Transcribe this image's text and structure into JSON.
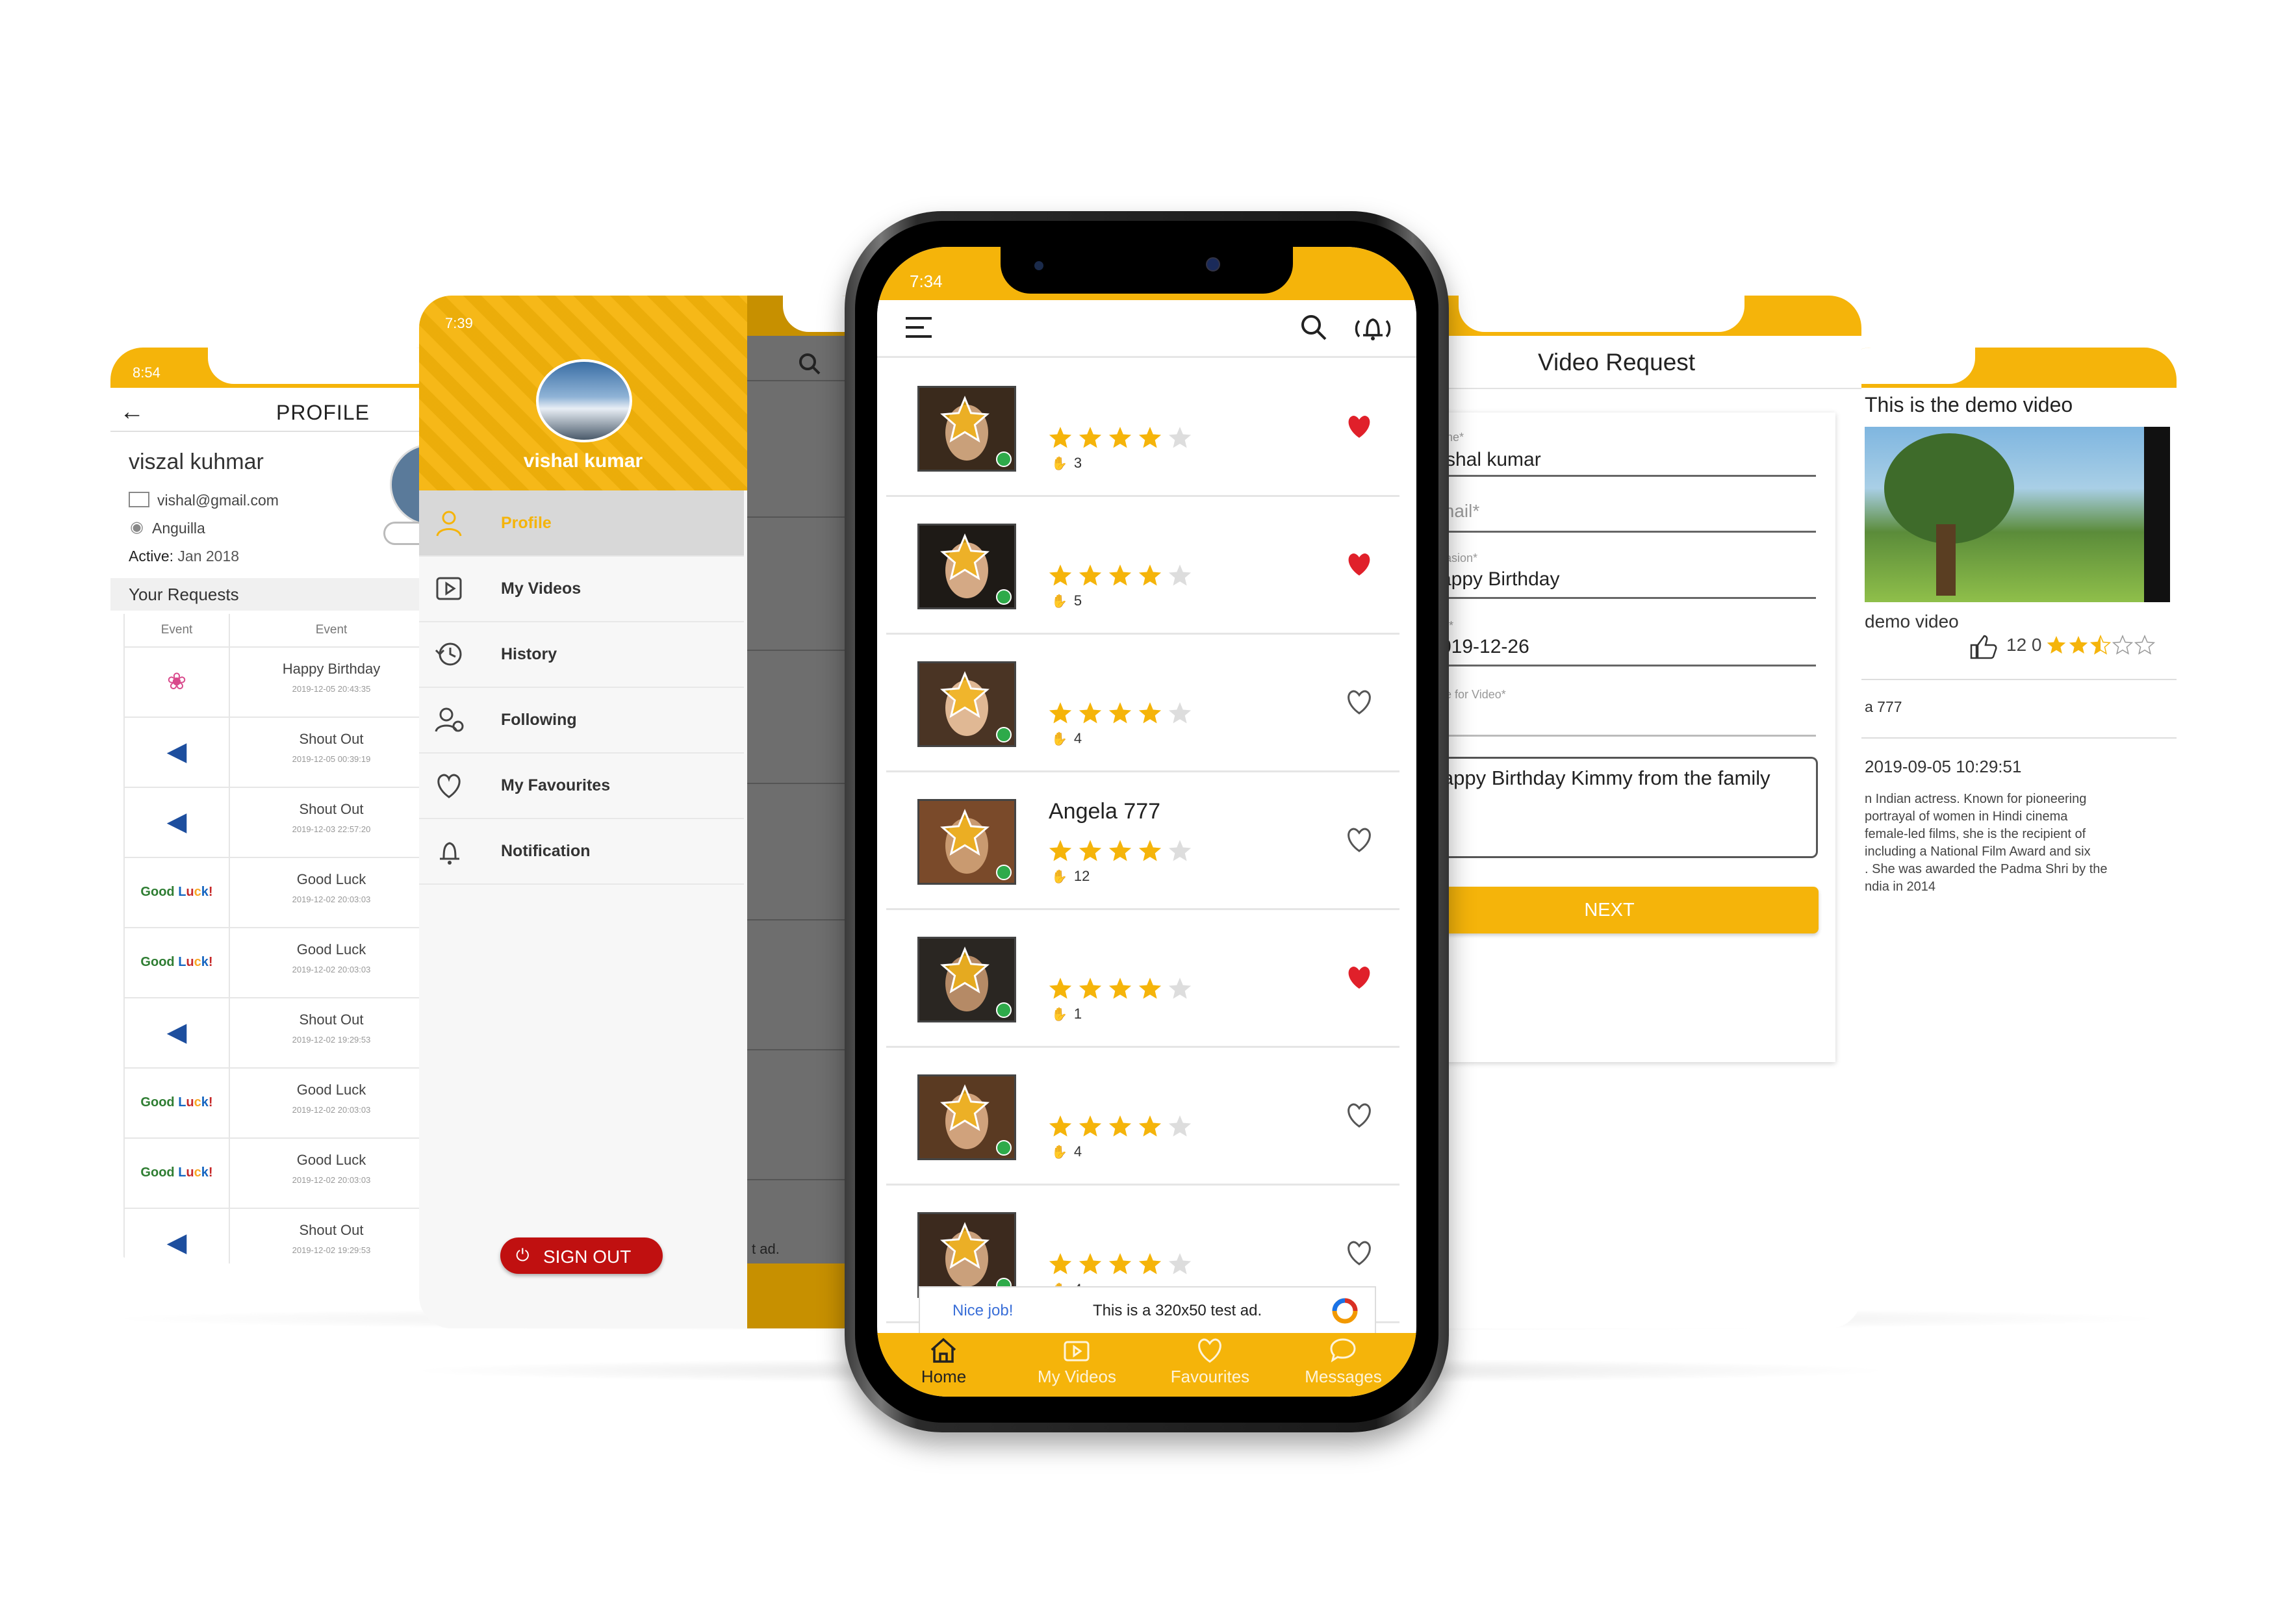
{
  "profile": {
    "status_time": "8:54",
    "title": "PROFILE",
    "name": "viszal kuhmar",
    "email": "vishal@gmail.com",
    "country": "Anguilla",
    "active_label": "Active:",
    "active_value": "Jan 2018",
    "requests_heading": "Your Requests",
    "col_event_1": "Event",
    "col_event_2": "Event",
    "requests": [
      {
        "icon": "balloon-icon",
        "title": "Happy Birthday",
        "date": "2019-12-05 20:43:35"
      },
      {
        "icon": "megaphone-icon",
        "title": "Shout Out",
        "date": "2019-12-05 00:39:19"
      },
      {
        "icon": "megaphone-icon",
        "title": "Shout Out",
        "date": "2019-12-03 22:57:20"
      },
      {
        "icon": "good-luck-badge",
        "badge": "Good Luck!",
        "title": "Good Luck",
        "date": "2019-12-02 20:03:03"
      },
      {
        "icon": "good-luck-badge",
        "badge": "Good Luck!",
        "title": "Good Luck",
        "date": "2019-12-02 20:03:03"
      },
      {
        "icon": "megaphone-icon",
        "title": "Shout Out",
        "date": "2019-12-02 19:29:53"
      },
      {
        "icon": "good-luck-badge",
        "badge": "Good Luck!",
        "title": "Good Luck",
        "date": "2019-12-02 20:03:03"
      },
      {
        "icon": "good-luck-badge",
        "badge": "Good Luck!",
        "title": "Good Luck",
        "date": "2019-12-02 20:03:03"
      },
      {
        "icon": "megaphone-icon",
        "title": "Shout Out",
        "date": "2019-12-02 19:29:53"
      }
    ]
  },
  "drawer": {
    "status_time": "7:39",
    "user_name": "vishal kumar",
    "items": [
      {
        "label": "Profile",
        "icon": "user-icon",
        "active": true
      },
      {
        "label": "My Videos",
        "icon": "play-icon"
      },
      {
        "label": "History",
        "icon": "history-icon"
      },
      {
        "label": "Following",
        "icon": "following-icon"
      },
      {
        "label": "My Favourites",
        "icon": "heart-icon"
      },
      {
        "label": "Notification",
        "icon": "bell-icon"
      }
    ],
    "sign_out": "SIGN OUT",
    "behind_ad": "t ad."
  },
  "main": {
    "status_time": "7:34",
    "rows": [
      {
        "name": "",
        "rating": 4,
        "likes": "3",
        "favourite": true
      },
      {
        "name": "",
        "rating": 4,
        "likes": "5",
        "favourite": true
      },
      {
        "name": "",
        "rating": 4,
        "likes": "4",
        "favourite": false
      },
      {
        "name": "Angela 777",
        "rating": 4,
        "likes": "12",
        "favourite": false
      },
      {
        "name": "",
        "rating": 4,
        "likes": "1",
        "favourite": true
      },
      {
        "name": "",
        "rating": 4,
        "likes": "4",
        "favourite": false
      },
      {
        "name": "",
        "rating": 4,
        "likes": "4",
        "favourite": false
      }
    ],
    "ad_nice": "Nice job!",
    "ad_text": "This is a 320x50 test ad.",
    "tabs": [
      {
        "label": "Home",
        "icon": "home-icon",
        "active": true
      },
      {
        "label": "My Videos",
        "icon": "video-icon"
      },
      {
        "label": "Favourites",
        "icon": "heart-icon"
      },
      {
        "label": "Messages",
        "icon": "chat-icon"
      }
    ]
  },
  "video_request": {
    "title": "Video Request",
    "name_label": "me*",
    "name_value": "shal kumar",
    "email_label": "mail*",
    "occasion_label": "casion*",
    "occasion_value": "appy Birthday",
    "date_label": "te*",
    "date_value": "019-12-26",
    "notes_label": "ce for Video*",
    "message": "lappy Birthday Kimmy from the family",
    "next": "NEXT"
  },
  "video_detail": {
    "title": "This is the demo video",
    "caption": "demo video",
    "likes": "12 0",
    "rating": 2.5,
    "name": "a 777",
    "datetime": "2019-09-05 10:29:51",
    "bio": [
      "n Indian actress. Known for pioneering",
      "portrayal of women in Hindi cinema",
      "female-led films, she is the recipient of",
      "including a National Film Award and six",
      ". She was awarded the Padma Shri by the",
      "ndia in 2014"
    ]
  },
  "colors": {
    "accent": "#f5b40a",
    "heart": "#e0202a",
    "signout": "#c01010"
  }
}
